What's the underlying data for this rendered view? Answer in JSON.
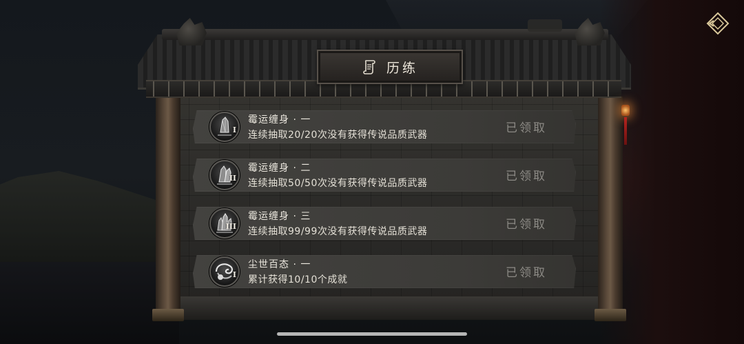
{
  "title_plaque": {
    "icon": "scroll-icon",
    "title": "历练"
  },
  "corner_button": {
    "icon": "diamond-arrow-icon",
    "color": "#d8c79a"
  },
  "tasks": [
    {
      "name": "霉运缠身 · 一",
      "description": "连续抽取20/20次没有获得传说品质武器",
      "rank": "I",
      "status": "已领取",
      "icon": "crystal-medal-icon"
    },
    {
      "name": "霉运缠身 · 二",
      "description": "连续抽取50/50次没有获得传说品质武器",
      "rank": "II",
      "status": "已领取",
      "icon": "crystal-medal-icon"
    },
    {
      "name": "霉运缠身 · 三",
      "description": "连续抽取99/99次没有获得传说品质武器",
      "rank": "III",
      "status": "已领取",
      "icon": "crystal-medal-icon"
    },
    {
      "name": "尘世百态 · 一",
      "description": "累计获得10/10个成就",
      "rank": "I",
      "status": "已领取",
      "icon": "dragon-medal-icon"
    }
  ]
}
